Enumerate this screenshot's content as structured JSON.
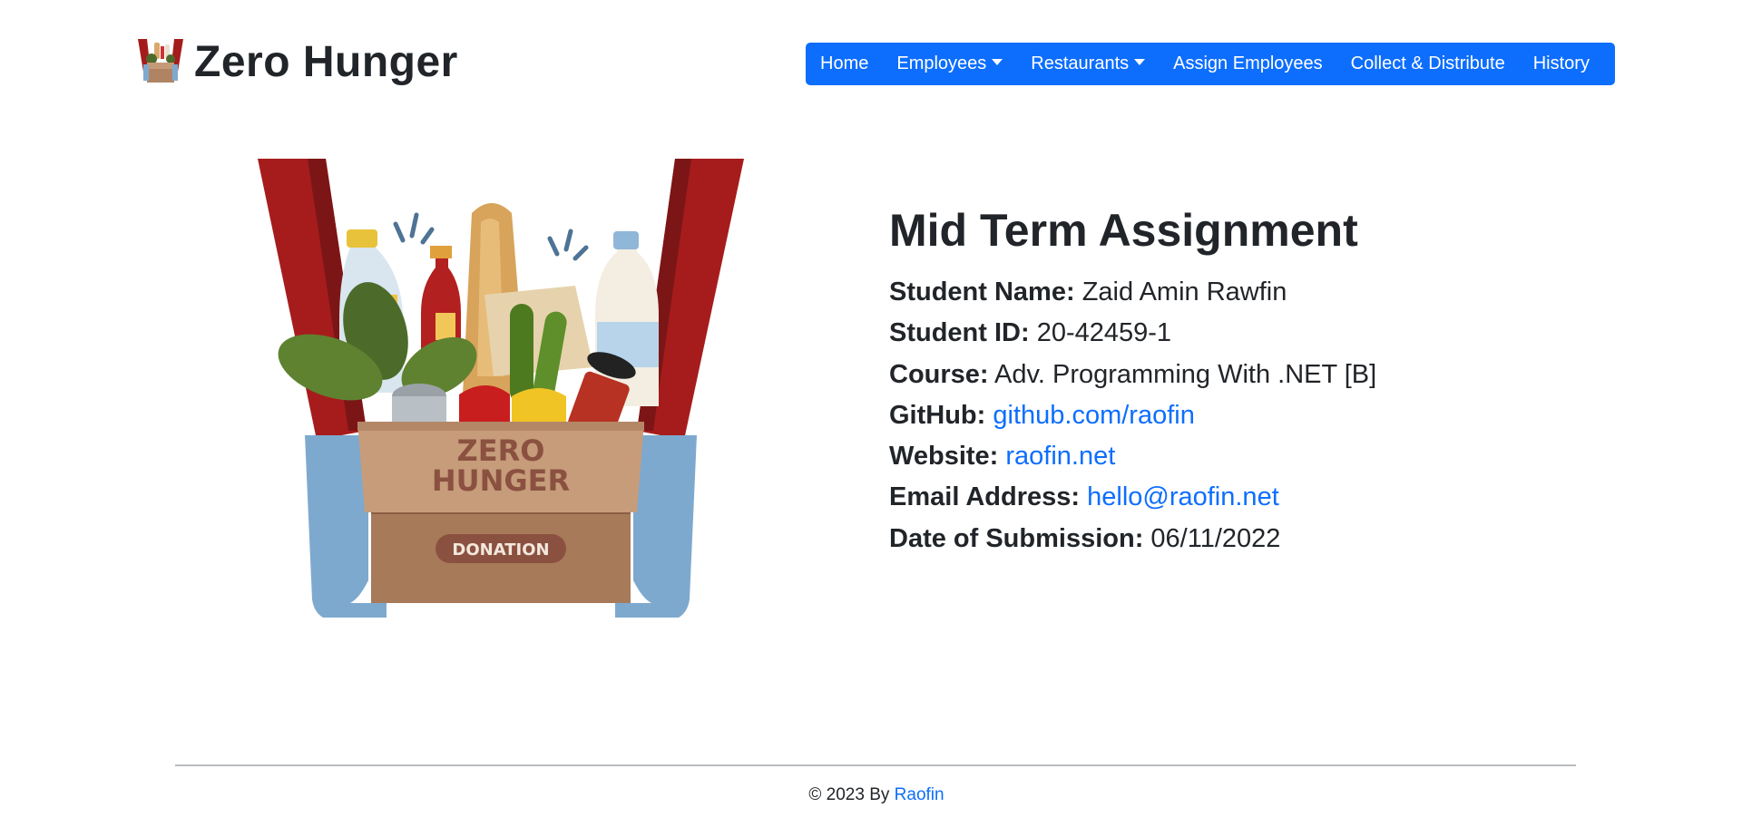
{
  "brand": {
    "name": "Zero Hunger",
    "logo_icon": "food-donation-box-icon"
  },
  "nav": {
    "items": [
      {
        "label": "Home",
        "dropdown": false
      },
      {
        "label": "Employees",
        "dropdown": true
      },
      {
        "label": "Restaurants",
        "dropdown": true
      },
      {
        "label": "Assign Employees",
        "dropdown": false
      },
      {
        "label": "Collect & Distribute",
        "dropdown": false
      },
      {
        "label": "History",
        "dropdown": false
      }
    ],
    "accent": "#0d6efd"
  },
  "hero": {
    "illustration": "zero-hunger-donation-box-illustration",
    "box_title": "ZERO\nHUNGER",
    "box_title_line1": "ZERO",
    "box_title_line2": "HUNGER",
    "box_badge": "DONATION"
  },
  "info": {
    "title": "Mid Term Assignment",
    "student_name_label": "Student Name:",
    "student_name": "Zaid Amin Rawfin",
    "student_id_label": "Student ID:",
    "student_id": "20-42459-1",
    "course_label": "Course:",
    "course": "Adv. Programming With .NET [B]",
    "github_label": "GitHub:",
    "github": "github.com/raofin",
    "website_label": "Website:",
    "website": "raofin.net",
    "email_label": "Email Address:",
    "email": "hello@raofin.net",
    "date_label": "Date of Submission:",
    "date": "06/11/2022"
  },
  "footer": {
    "prefix": "© 2023 By",
    "author": "Raofin"
  }
}
